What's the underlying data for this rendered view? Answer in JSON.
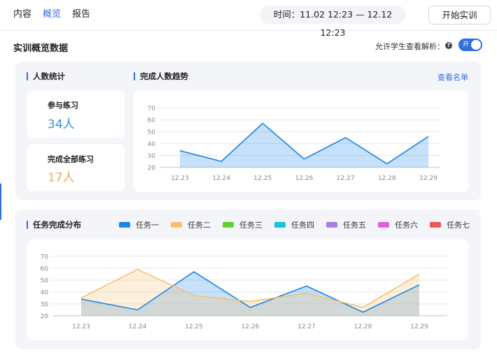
{
  "nav": {
    "items": [
      {
        "label": "内容",
        "active": false
      },
      {
        "label": "概览",
        "active": true
      },
      {
        "label": "报告",
        "active": false
      }
    ]
  },
  "header": {
    "time_range": "时间：11.02 12:23 — 12.12 12:23",
    "start_button": "开始实训"
  },
  "page": {
    "title": "实训概览数据",
    "allow_label": "允许学生查看解析：",
    "help_icon_text": "?",
    "toggle_label": "开",
    "toggle_on": true
  },
  "stats": {
    "section_title": "人数统计",
    "participate_label": "参与练习",
    "participate_value": "34人",
    "complete_label": "完成全部练习",
    "complete_value": "17人"
  },
  "trend": {
    "section_title": "完成人数趋势",
    "view_list_link": "查看名单"
  },
  "distribution": {
    "section_title": "任务完成分布",
    "legend": [
      {
        "label": "任务一",
        "color": "#1a86e6"
      },
      {
        "label": "任务二",
        "color": "#f7c06e"
      },
      {
        "label": "任务三",
        "color": "#5dd32c"
      },
      {
        "label": "任务四",
        "color": "#18c3e0"
      },
      {
        "label": "任务五",
        "color": "#a77be8"
      },
      {
        "label": "任务六",
        "color": "#dd5ee0"
      },
      {
        "label": "任务七",
        "color": "#ef5757"
      }
    ]
  },
  "colors": {
    "accent": "#2f6fe0",
    "participate_value": "#3a8fe8",
    "complete_value": "#f2a95a"
  },
  "chart_data": [
    {
      "type": "area",
      "x": [
        "12.23",
        "12.24",
        "12.25",
        "12.26",
        "12.27",
        "12.28",
        "12.29"
      ],
      "series": [
        {
          "values": [
            34,
            25,
            57,
            27,
            45,
            23,
            46
          ],
          "color": "#1a86e6"
        }
      ],
      "yticks": [
        20,
        30,
        40,
        50,
        60,
        70
      ],
      "ylim": [
        20,
        70
      ],
      "grid": true
    },
    {
      "type": "area",
      "x": [
        "12.23",
        "12.24",
        "12.25",
        "12.26",
        "12.27",
        "12.28",
        "12.29"
      ],
      "series": [
        {
          "name": "任务一",
          "values": [
            34,
            25,
            57,
            27,
            45,
            23,
            46
          ],
          "color": "#1a86e6"
        },
        {
          "name": "任务二",
          "values": [
            35,
            59,
            37,
            32,
            39,
            27,
            55
          ],
          "color": "#f7c06e"
        }
      ],
      "yticks": [
        20,
        30,
        40,
        50,
        60,
        70
      ],
      "ylim": [
        20,
        70
      ],
      "grid": true,
      "legend": "top"
    }
  ]
}
